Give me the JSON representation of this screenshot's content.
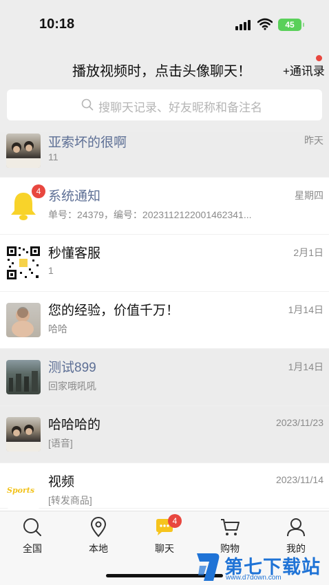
{
  "status": {
    "time": "10:18",
    "battery": "45"
  },
  "header": {
    "title": "播放视频时，点击头像聊天！",
    "contacts_label": "+通讯录"
  },
  "search": {
    "placeholder": "搜聊天记录、好友昵称和备注名"
  },
  "chats": [
    {
      "name": "亚索坏的很啊",
      "message": "11",
      "time": "昨天",
      "avatar_icon": "children-photo",
      "highlight": true,
      "name_blue": true
    },
    {
      "name": "系统通知",
      "message": "单号：24379，编号：2023112122001462341...",
      "time": "星期四",
      "avatar_icon": "bell-icon",
      "badge": "4",
      "highlight": false,
      "name_blue": true
    },
    {
      "name": "秒懂客服",
      "message": "1",
      "time": "2月1日",
      "avatar_icon": "qr-code",
      "highlight": false,
      "name_blue": false
    },
    {
      "name": "您的经验，价值千万！",
      "message": "哈哈",
      "time": "1月14日",
      "avatar_icon": "baby-photo",
      "highlight": false,
      "name_blue": false
    },
    {
      "name": "测试899",
      "message": "回家哦吼吼",
      "time": "1月14日",
      "avatar_icon": "city-photo",
      "highlight": true,
      "name_blue": true
    },
    {
      "name": "哈哈哈的",
      "message": "[语音]",
      "time": "2023/11/23",
      "avatar_icon": "children-photo",
      "highlight": true,
      "name_blue": false
    },
    {
      "name": "视频",
      "message": "[转发商品]",
      "time": "2023/11/14",
      "avatar_icon": "sports-logo",
      "avatar_text": "Sports",
      "highlight": false,
      "name_blue": false
    }
  ],
  "tabs": [
    {
      "label": "全国",
      "icon": "search-icon"
    },
    {
      "label": "本地",
      "icon": "location-pin-icon"
    },
    {
      "label": "聊天",
      "icon": "chat-bubble-icon",
      "badge": "4"
    },
    {
      "label": "购物",
      "icon": "cart-icon"
    },
    {
      "label": "我的",
      "icon": "person-icon"
    }
  ],
  "watermark": {
    "text": "第七下载站",
    "url": "www.d7down.com"
  },
  "colors": {
    "accent_blue": "#5d6f95",
    "badge_red": "#e8473f",
    "bell_yellow": "#f8d32a",
    "chat_yellow": "#f6c41d",
    "battery_green": "#5ad05a"
  }
}
